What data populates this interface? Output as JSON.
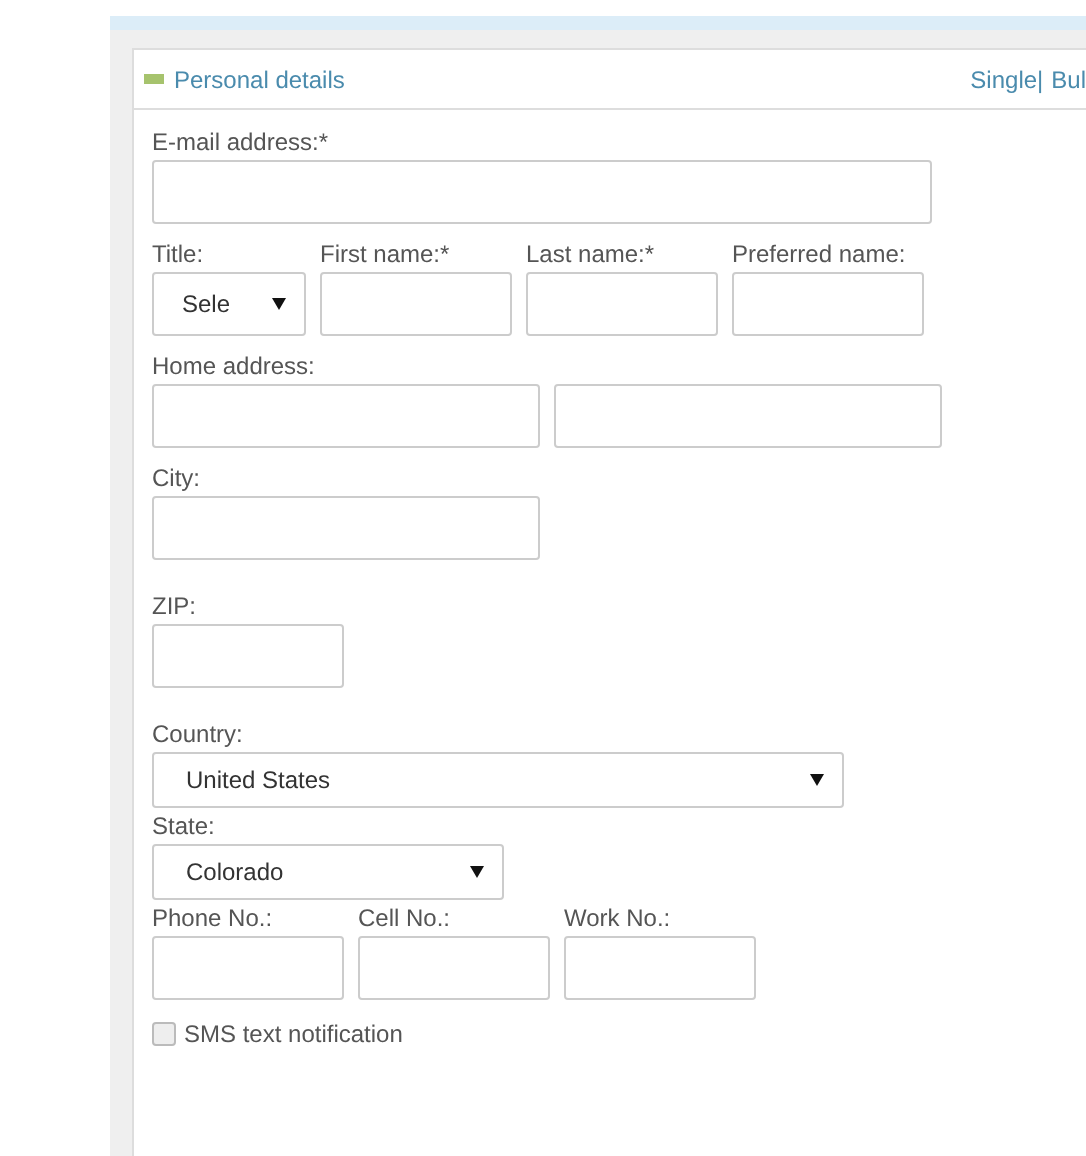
{
  "panel": {
    "title": "Personal details",
    "expanded": true,
    "links": [
      "Single|",
      "Bul"
    ]
  },
  "rows": [
    {
      "fields": [
        {
          "kind": "text",
          "label": "E-mail address:*"
        }
      ]
    },
    {
      "fields": [
        {
          "kind": "select",
          "label": "Title:",
          "value": "Sele"
        },
        {
          "kind": "text",
          "label": "First name:*"
        },
        {
          "kind": "text",
          "label": "Last name:*"
        },
        {
          "kind": "text",
          "label": "Preferred name:"
        }
      ]
    },
    {
      "fields": [
        {
          "kind": "text",
          "label": "Home address:"
        },
        {
          "kind": "text"
        }
      ]
    },
    {
      "fields": [
        {
          "kind": "text",
          "label": "City:"
        }
      ]
    },
    {
      "fields": [
        {
          "kind": "text",
          "label": "ZIP:"
        }
      ]
    },
    {
      "fields": [
        {
          "kind": "select",
          "label": "Country:",
          "value": "United States"
        }
      ]
    },
    {
      "fields": [
        {
          "kind": "select",
          "label": "State:",
          "value": "Colorado"
        }
      ]
    },
    {
      "fields": [
        {
          "kind": "text",
          "label": "Phone No.:"
        },
        {
          "kind": "text",
          "label": "Cell No.:"
        },
        {
          "kind": "text",
          "label": "Work No.:"
        }
      ]
    },
    {
      "fields": [
        {
          "kind": "checkbox",
          "label": "SMS text notification",
          "checked": false
        }
      ]
    }
  ]
}
